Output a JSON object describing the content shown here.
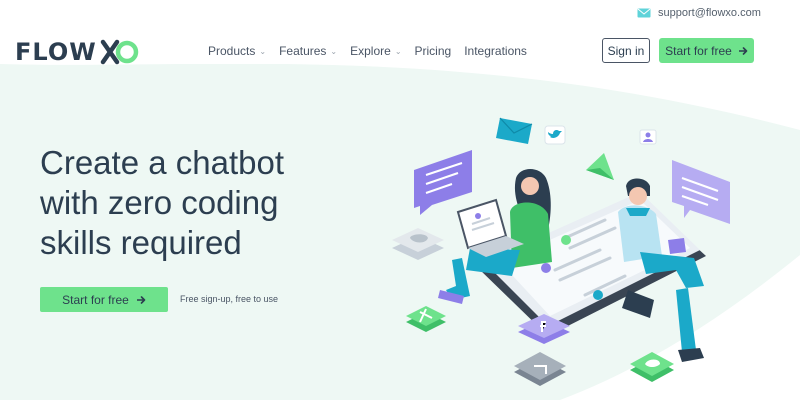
{
  "topbar": {
    "email": "support@flowxo.com",
    "email_icon": "mail-icon"
  },
  "logo": {
    "text": "FLOW",
    "mark": "xo-logo-mark"
  },
  "nav": {
    "items": [
      {
        "label": "Products",
        "has_dropdown": true
      },
      {
        "label": "Features",
        "has_dropdown": true
      },
      {
        "label": "Explore",
        "has_dropdown": true
      },
      {
        "label": "Pricing",
        "has_dropdown": false
      },
      {
        "label": "Integrations",
        "has_dropdown": false
      }
    ],
    "dropdown_glyph": "⌄",
    "signin_label": "Sign in",
    "start_label": "Start for free"
  },
  "hero": {
    "headline_lines": [
      "Create a chatbot",
      "with zero coding",
      "skills required"
    ],
    "cta_label": "Start for free",
    "cta_note": "Free sign-up, free to use"
  },
  "colors": {
    "brand_green": "#6ee28c",
    "text_dark": "#2c3e50",
    "hero_bg": "#eef8f4",
    "purple": "#8d7ee8",
    "teal": "#1ba9c9"
  }
}
